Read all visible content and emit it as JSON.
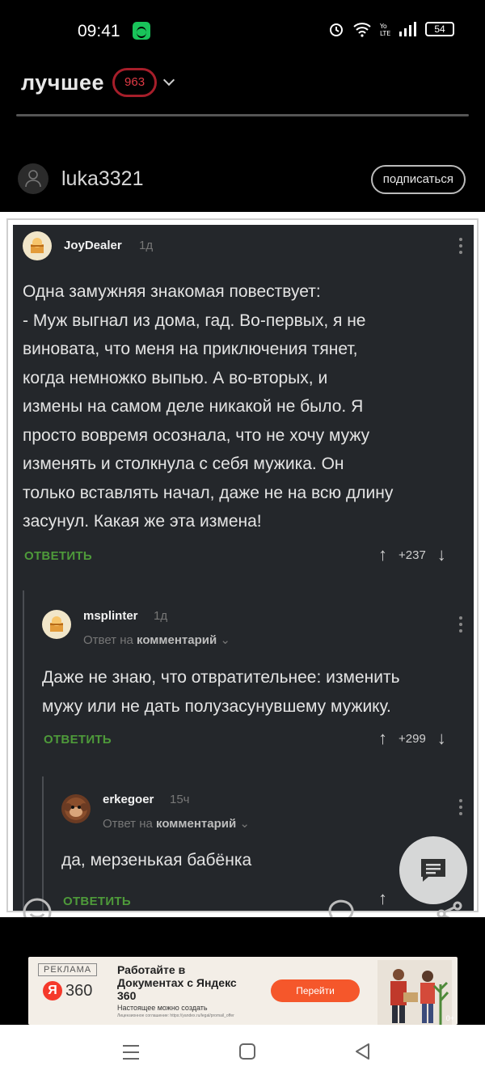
{
  "status_bar": {
    "time": "09:41",
    "battery": "54"
  },
  "header": {
    "title": "лучшее",
    "count": "963"
  },
  "post_author": {
    "name": "luka3321",
    "subscribe_label": "подписаться"
  },
  "comments": [
    {
      "user": "JoyDealer",
      "time": "1д",
      "text_lines": [
        "Одна замужняя знакомая повествует:",
        "- Муж выгнал из дома, гад. Во-первых, я не",
        "виновата, что меня на приключения тянет,",
        "когда немножко выпью. А во-вторых, и",
        "измены на самом деле никакой не было. Я",
        "просто вовремя осознала, что не хочу мужу",
        "изменять и столкнула с себя мужика. Он",
        "только вставлять начал, даже не на всю длину",
        "засунул. Какая же эта измена!"
      ],
      "reply_label": "ОТВЕТИТЬ",
      "score": "+237"
    },
    {
      "user": "msplinter",
      "time": "1д",
      "reply_prefix": "Ответ на",
      "reply_target": "комментарий",
      "text_lines": [
        "Даже не знаю, что отвратительнее: изменить",
        "мужу или не дать полузасунувшему мужику."
      ],
      "reply_label": "ОТВЕТИТЬ",
      "score": "+299"
    },
    {
      "user": "erkegoer",
      "time": "15ч",
      "reply_prefix": "Ответ на",
      "reply_target": "комментарий",
      "text_lines": [
        "да, мерзенькая бабёнка"
      ],
      "reply_label": "ОТВЕТИТЬ"
    }
  ],
  "ad": {
    "label": "РЕКЛАМА",
    "logo_letter": "Я",
    "logo_text": "360",
    "title": "Работайте в Документах с Яндекс 360",
    "subtitle": "Настоящее можно создать",
    "fine_print": "Лицензионное соглашение: https://yandex.ru/legal/promail_offer",
    "button": "Перейти",
    "age": "0+"
  },
  "icons": {
    "menu": "menu-icon",
    "home": "home-icon",
    "back": "back-icon",
    "comments_fab": "comments-icon"
  },
  "colors": {
    "background": "#000000",
    "comment_bg": "#24272b",
    "accent_green": "#4e9a3a",
    "badge_red": "#a61e2a"
  }
}
